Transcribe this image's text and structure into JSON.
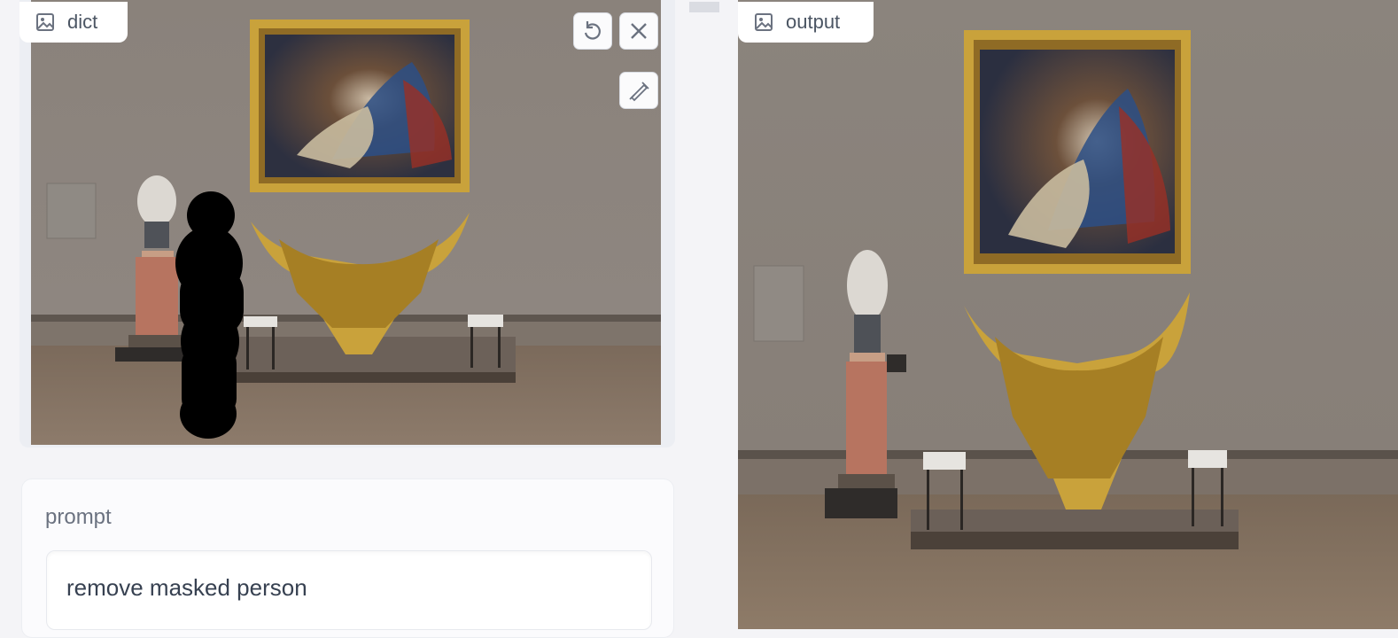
{
  "input_panel": {
    "label": "dict",
    "label_icon": "image-icon",
    "toolbar": {
      "undo_icon": "undo-icon",
      "close_icon": "close-icon",
      "brush_icon": "brush-icon"
    }
  },
  "prompt": {
    "label": "prompt",
    "value": "remove masked person"
  },
  "output_panel": {
    "label": "output",
    "label_icon": "image-icon"
  },
  "colors": {
    "panel_background": "#f4f4f7",
    "mask": "#000000",
    "gallery_wall": "#8f8780",
    "frame_gold": "#c9a23b"
  }
}
